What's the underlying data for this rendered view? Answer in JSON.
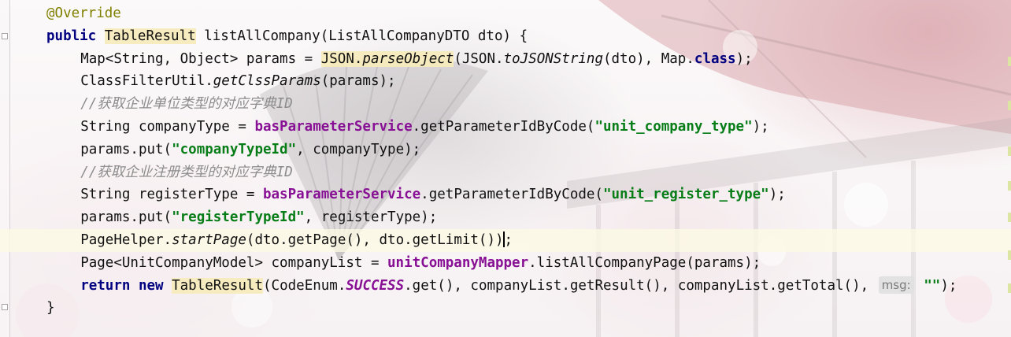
{
  "editor": {
    "lines": [
      {
        "indent": 4,
        "current": false,
        "tokens": [
          {
            "t": "@Override",
            "c": "ann"
          }
        ]
      },
      {
        "indent": 4,
        "current": false,
        "tokens": [
          {
            "t": "public",
            "c": "kw"
          },
          {
            "t": " "
          },
          {
            "t": "TableResult",
            "c": "hl"
          },
          {
            "t": " listAllCompany(ListAllCompanyDTO dto) {"
          }
        ]
      },
      {
        "indent": 8,
        "current": false,
        "tokens": [
          {
            "t": "Map<String, Object> params = "
          },
          {
            "t": "JSON.",
            "c": "hl"
          },
          {
            "t": "parseObject",
            "c": "hl ital"
          },
          {
            "t": "(JSON."
          },
          {
            "t": "toJSONString",
            "c": "ital"
          },
          {
            "t": "(dto), Map."
          },
          {
            "t": "class",
            "c": "kw"
          },
          {
            "t": ");"
          }
        ]
      },
      {
        "indent": 8,
        "current": false,
        "tokens": [
          {
            "t": "ClassFilterUtil."
          },
          {
            "t": "getClssParams",
            "c": "ital"
          },
          {
            "t": "(params);"
          }
        ]
      },
      {
        "indent": 8,
        "current": false,
        "tokens": [
          {
            "t": "//获取企业单位类型的对应字典ID",
            "c": "cmt"
          }
        ]
      },
      {
        "indent": 8,
        "current": false,
        "tokens": [
          {
            "t": "String companyType = "
          },
          {
            "t": "basParameterService",
            "c": "fld"
          },
          {
            "t": ".getParameterIdByCode("
          },
          {
            "t": "\"unit_company_type\"",
            "c": "str"
          },
          {
            "t": ");"
          }
        ]
      },
      {
        "indent": 8,
        "current": false,
        "tokens": [
          {
            "t": "params.put("
          },
          {
            "t": "\"companyTypeId\"",
            "c": "str"
          },
          {
            "t": ", companyType);"
          }
        ]
      },
      {
        "indent": 8,
        "current": false,
        "tokens": [
          {
            "t": "//获取企业注册类型的对应字典ID",
            "c": "cmt"
          }
        ]
      },
      {
        "indent": 8,
        "current": false,
        "tokens": [
          {
            "t": "String registerType = "
          },
          {
            "t": "basParameterService",
            "c": "fld"
          },
          {
            "t": ".getParameterIdByCode("
          },
          {
            "t": "\"unit_register_type\"",
            "c": "str"
          },
          {
            "t": ");"
          }
        ]
      },
      {
        "indent": 8,
        "current": false,
        "tokens": [
          {
            "t": "params.put("
          },
          {
            "t": "\"registerTypeId\"",
            "c": "str"
          },
          {
            "t": ", registerType);"
          }
        ]
      },
      {
        "indent": 8,
        "current": true,
        "caret": true,
        "tokens": [
          {
            "t": "PageHelper."
          },
          {
            "t": "startPage",
            "c": "ital"
          },
          {
            "t": "(dto.getPage(), dto.getLimit());"
          }
        ]
      },
      {
        "indent": 8,
        "current": false,
        "tokens": [
          {
            "t": "Page<UnitCompanyModel> companyList = "
          },
          {
            "t": "unitCompanyMapper",
            "c": "fld"
          },
          {
            "t": ".listAllCompanyPage(params);"
          }
        ]
      },
      {
        "indent": 8,
        "current": false,
        "tokens": [
          {
            "t": "return",
            "c": "kw"
          },
          {
            "t": " "
          },
          {
            "t": "new",
            "c": "kw"
          },
          {
            "t": " "
          },
          {
            "t": "TableResult",
            "c": "hl"
          },
          {
            "t": "(CodeEnum."
          },
          {
            "t": "SUCCESS",
            "c": "sfld"
          },
          {
            "t": ".get(), companyList.getResult(), companyList.getTotal(), "
          },
          {
            "t": "msg:",
            "c": "hint"
          },
          {
            "t": " "
          },
          {
            "t": "\"\"",
            "c": "str"
          },
          {
            "t": ");"
          }
        ]
      },
      {
        "indent": 4,
        "current": false,
        "tokens": [
          {
            "t": "}"
          }
        ]
      }
    ]
  }
}
